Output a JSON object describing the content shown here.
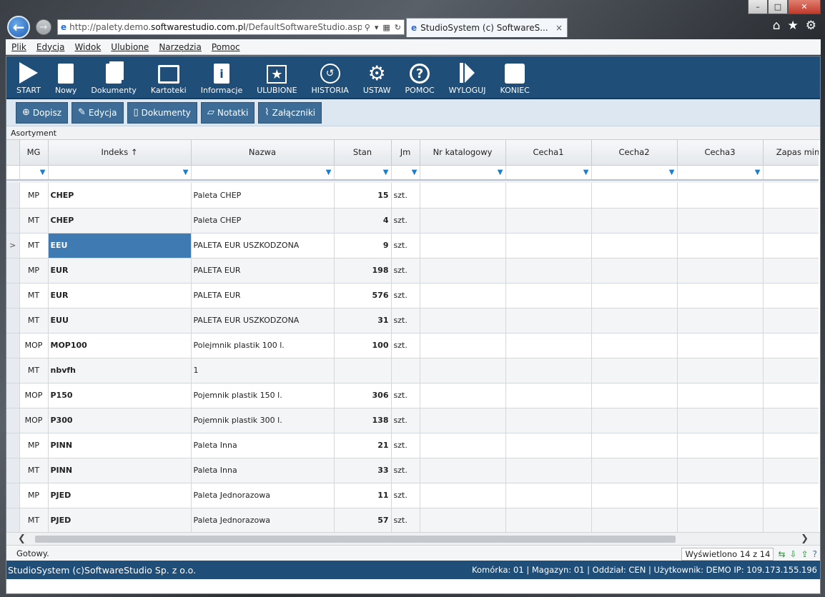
{
  "browser": {
    "url_prefix": "http://palety.demo.",
    "url_domain": "softwarestudio.com.pl",
    "url_suffix": "/DefaultSoftwareStudio.aspx?rol",
    "tab_title": "StudioSystem (c) SoftwareS...",
    "tab_close": "×"
  },
  "menu": [
    "Plik",
    "Edycja",
    "Widok",
    "Ulubione",
    "Narzędzia",
    "Pomoc"
  ],
  "toolbar": [
    {
      "label": "START",
      "icon": "play-icon"
    },
    {
      "label": "Nowy",
      "icon": "new-document-icon"
    },
    {
      "label": "Dokumenty",
      "icon": "documents-icon"
    },
    {
      "label": "Kartoteki",
      "icon": "card-file-icon"
    },
    {
      "label": "Informacje",
      "icon": "info-icon"
    },
    {
      "label": "ULUBIONE",
      "icon": "favorites-star-icon"
    },
    {
      "label": "HISTORIA",
      "icon": "history-icon"
    },
    {
      "label": "USTAW",
      "icon": "gears-icon"
    },
    {
      "label": "POMOC",
      "icon": "help-icon"
    },
    {
      "label": "WYLOGUJ",
      "icon": "logout-icon"
    },
    {
      "label": "KONIEC",
      "icon": "exit-square-icon"
    }
  ],
  "subtoolbar": [
    {
      "label": "Dopisz",
      "icon": "plus-circle-icon"
    },
    {
      "label": "Edycja",
      "icon": "edit-icon"
    },
    {
      "label": "Dokumenty",
      "icon": "document-icon"
    },
    {
      "label": "Notatki",
      "icon": "notes-icon"
    },
    {
      "label": "Załączniki",
      "icon": "paperclip-icon"
    }
  ],
  "section_label": "Asortyment",
  "grid": {
    "columns": [
      "MG",
      "Indeks ↑",
      "Nazwa",
      "Stan",
      "Jm",
      "Nr katalogowy",
      "Cecha1",
      "Cecha2",
      "Cecha3",
      "Zapas min"
    ],
    "rows": [
      {
        "mg": "MP",
        "indeks": "CHEP",
        "nazwa": "Paleta CHEP",
        "stan": "15",
        "jm": "szt."
      },
      {
        "mg": "MT",
        "indeks": "CHEP",
        "nazwa": "Paleta CHEP",
        "stan": "4",
        "jm": "szt."
      },
      {
        "mg": "MT",
        "indeks": "EEU",
        "nazwa": "PALETA EUR USZKODZONA",
        "stan": "9",
        "jm": "szt."
      },
      {
        "mg": "MP",
        "indeks": "EUR",
        "nazwa": "PALETA EUR",
        "stan": "198",
        "jm": "szt."
      },
      {
        "mg": "MT",
        "indeks": "EUR",
        "nazwa": "PALETA EUR",
        "stan": "576",
        "jm": "szt."
      },
      {
        "mg": "MT",
        "indeks": "EUU",
        "nazwa": "PALETA EUR USZKODZONA",
        "stan": "31",
        "jm": "szt."
      },
      {
        "mg": "MOP",
        "indeks": "MOP100",
        "nazwa": "Polejmnik plastik 100 l.",
        "stan": "100",
        "jm": "szt."
      },
      {
        "mg": "MT",
        "indeks": "nbvfh",
        "nazwa": "1",
        "stan": "",
        "jm": ""
      },
      {
        "mg": "MOP",
        "indeks": "P150",
        "nazwa": "Pojemnik plastik 150 l.",
        "stan": "306",
        "jm": "szt."
      },
      {
        "mg": "MOP",
        "indeks": "P300",
        "nazwa": "Pojemnik plastik 300 l.",
        "stan": "138",
        "jm": "szt."
      },
      {
        "mg": "MP",
        "indeks": "PINN",
        "nazwa": "Paleta Inna",
        "stan": "21",
        "jm": "szt."
      },
      {
        "mg": "MT",
        "indeks": "PINN",
        "nazwa": "Paleta Inna",
        "stan": "33",
        "jm": "szt."
      },
      {
        "mg": "MP",
        "indeks": "PJED",
        "nazwa": "Paleta Jednorazowa",
        "stan": "11",
        "jm": "szt."
      },
      {
        "mg": "MT",
        "indeks": "PJED",
        "nazwa": "Paleta Jednorazowa",
        "stan": "57",
        "jm": "szt."
      }
    ],
    "selected_row_index": 2,
    "selected_marker": ">"
  },
  "status": {
    "text": "Gotowy.",
    "count": "Wyświetlono 14 z 14"
  },
  "footer": {
    "left": "StudioSystem (c)SoftwareStudio Sp. z o.o.",
    "right": "Komórka: 01 | Magazyn: 01 | Oddział: CEN | Użytkownik: DEMO IP: 109.173.155.196"
  },
  "colors": {
    "toolbar_bg": "#1f4e79",
    "selected_cell": "#3f7ab3",
    "subbutton": "#3d6c97"
  }
}
